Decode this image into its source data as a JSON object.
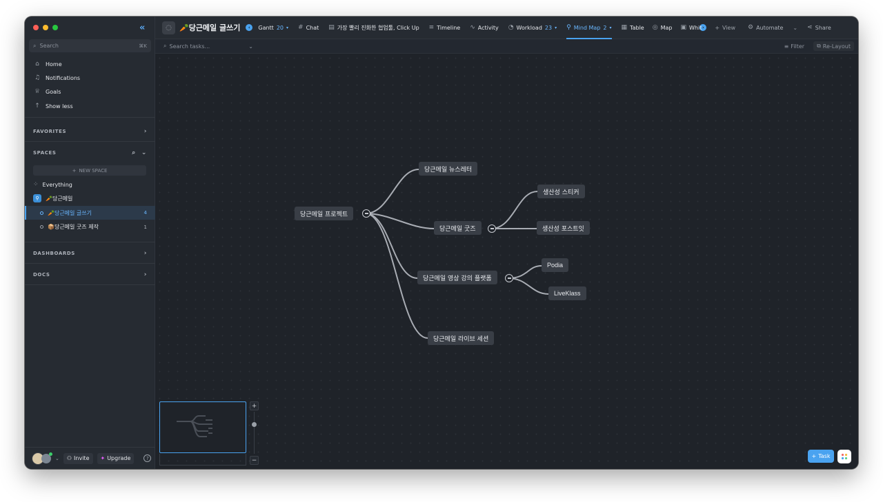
{
  "sidebar": {
    "search_placeholder": "Search",
    "search_shortcut": "⌘K",
    "nav": [
      {
        "label": "Home",
        "icon": "home-icon"
      },
      {
        "label": "Notifications",
        "icon": "bell-icon"
      },
      {
        "label": "Goals",
        "icon": "trophy-icon"
      },
      {
        "label": "Show less",
        "icon": "arrow-up-icon"
      }
    ],
    "favorites": "FAVORITES",
    "spaces": "SPACES",
    "new_space": "NEW SPACE",
    "everything": "Everything",
    "space_name": "🥕당근메일",
    "lists": [
      {
        "label": "🥕당근메일 글쓰기",
        "count": "4"
      },
      {
        "label": "📦당근메일 굿즈 제작",
        "count": "1"
      }
    ],
    "dashboards": "DASHBOARDS",
    "docs": "DOCS",
    "invite": "Invite",
    "upgrade": "Upgrade"
  },
  "topbar": {
    "title": "🥕당근메일 글쓰기",
    "tabs": [
      {
        "label": "Gantt",
        "count": "20",
        "icon": "gantt-icon"
      },
      {
        "label": "Chat",
        "icon": "hash-icon"
      },
      {
        "label": "가장 빨리 진화한 협업툴, Click Up",
        "icon": "doc-icon"
      },
      {
        "label": "Timeline",
        "icon": "timeline-icon"
      },
      {
        "label": "Activity",
        "icon": "activity-icon"
      },
      {
        "label": "Workload",
        "count": "23",
        "icon": "gauge-icon"
      },
      {
        "label": "Mind Map",
        "count": "2",
        "icon": "mindmap-icon",
        "active": true
      },
      {
        "label": "Table",
        "icon": "table-icon"
      },
      {
        "label": "Map",
        "icon": "map-pin-icon"
      },
      {
        "label": "Whit",
        "icon": "whiteboard-icon"
      }
    ],
    "view": "View",
    "automate": "Automate",
    "share": "Share"
  },
  "subbar": {
    "search_placeholder": "Search tasks...",
    "filter": "Filter",
    "relayout": "Re-Layout"
  },
  "mindmap": {
    "root": "당근메일 프로젝트",
    "children": [
      {
        "label": "당근메일 뉴스레터",
        "children": []
      },
      {
        "label": "당근메일 굿즈",
        "children": [
          "생산성 스티커",
          "생산성 포스트잇"
        ]
      },
      {
        "label": "당근메일 영상 강의 플랫폼",
        "children": [
          "Podia",
          "LiveKlass"
        ]
      },
      {
        "label": "당근메일 라이브 세션",
        "children": []
      }
    ]
  },
  "footer": {
    "task_button": "Task"
  },
  "colors": {
    "accent": "#4aa3f0",
    "background": "#1f2329",
    "node": "#393e46"
  }
}
